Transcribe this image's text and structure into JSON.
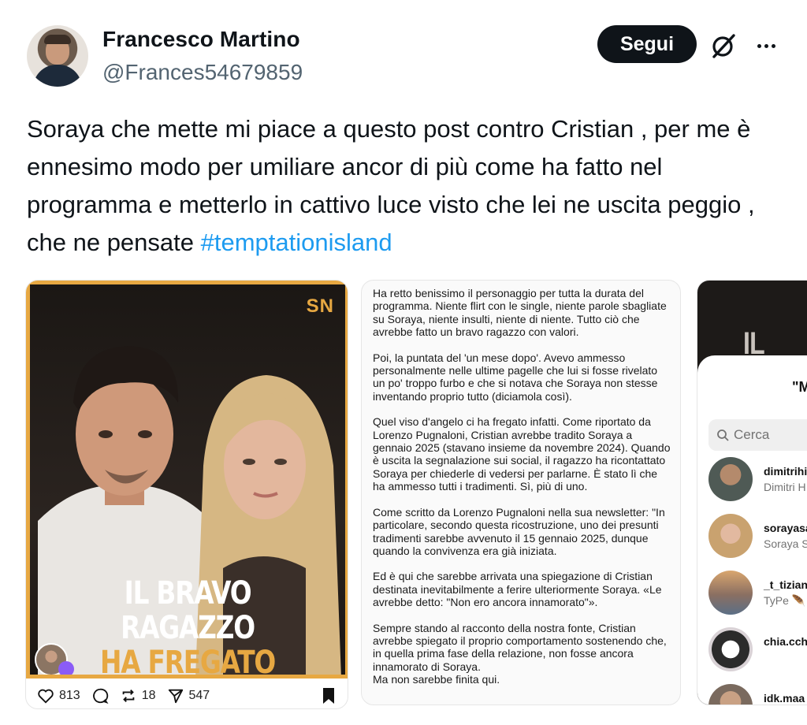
{
  "author": {
    "name": "Francesco Martino",
    "handle": "@Frances54679859"
  },
  "actions": {
    "follow_label": "Segui",
    "grok_icon": "grok-icon",
    "more_icon": "more-icon"
  },
  "tweet": {
    "text": "Soraya che mette mi piace a questo post contro Cristian , per me è ennesimo modo per umiliare ancor di più come ha fatto nel programma e metterlo in cattivo luce visto che lei ne uscita peggio , che ne pensate ",
    "hashtag": "#temptationisland"
  },
  "media": {
    "card1": {
      "logo": "SN",
      "headline_line1": "IL BRAVO RAGAZZO",
      "headline_line2": "HA FREGATO TUTTI",
      "likes": "813",
      "reposts": "18",
      "shares": "547",
      "accent": "#e7a842"
    },
    "card2": {
      "paragraphs": [
        "Ha retto benissimo il personaggio per tutta la durata del programma. Niente flirt con le single, niente parole sbagliate su Soraya, niente insulti, niente di niente. Tutto ciò che avrebbe fatto un bravo ragazzo con valori.",
        "Poi, la puntata del 'un mese dopo'. Avevo ammesso personalmente nelle ultime pagelle che lui si fosse rivelato un po' troppo furbo e che si notava che Soraya non stesse inventando proprio tutto (diciamola così).",
        "Quel viso d'angelo ci ha fregato infatti. Come riportato da Lorenzo Pugnaloni, Cristian avrebbe tradito Soraya a gennaio 2025 (stavano insieme da novembre 2024). Quando è uscita la segnalazione sui social, il ragazzo ha ricontattato Soraya per chiederle di vedersi per parlarne. È stato lì che ha ammesso tutti i tradimenti. Sì, più di uno.",
        "Come scritto da Lorenzo Pugnaloni nella sua newsletter: \"In particolare, secondo questa ricostruzione, uno dei presunti tradimenti sarebbe avvenuto il 15 gennaio 2025, dunque quando la convivenza era già iniziata.",
        "Ed è qui che sarebbe arrivata una spiegazione di Cristian destinata inevitabilmente a ferire ulteriormente Soraya. «Le avrebbe detto: \"Non ero ancora innamorato\"».",
        "Sempre stando al racconto della nostra fonte, Cristian avrebbe spiegato il proprio comportamento sostenendo che, in quella prima fase della relazione, non fosse ancora innamorato di Soraya.\nMa non sarebbe finita qui."
      ]
    },
    "card3": {
      "bg_text": "IL BRA",
      "title_fragment": "\"M",
      "search_placeholder": "Cerca",
      "users": [
        {
          "username": "dimitrihi",
          "fullname": "Dimitri H"
        },
        {
          "username": "sorayasa",
          "fullname": "Soraya S"
        },
        {
          "username": "_t_tizian",
          "fullname": "TyPe 🪶"
        },
        {
          "username": "chia.cch",
          "fullname": ""
        },
        {
          "username": "idk.maa",
          "fullname": ""
        }
      ]
    }
  }
}
